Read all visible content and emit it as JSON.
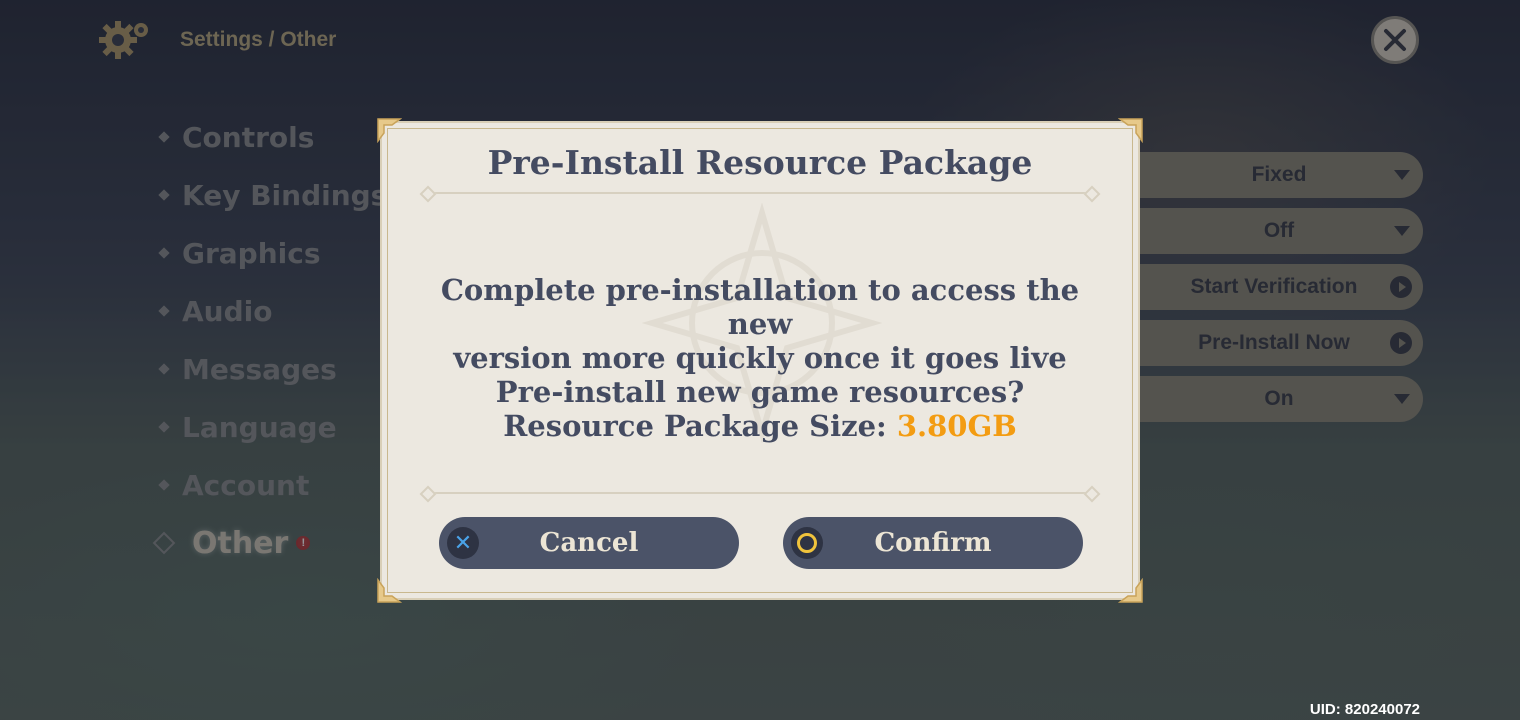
{
  "header": {
    "breadcrumb": "Settings / Other",
    "settings_icon": "gear-icon",
    "close_icon": "close-icon"
  },
  "sidebar": {
    "items": [
      {
        "label": "Controls"
      },
      {
        "label": "Key Bindings"
      },
      {
        "label": "Graphics"
      },
      {
        "label": "Audio"
      },
      {
        "label": "Messages"
      },
      {
        "label": "Language"
      },
      {
        "label": "Account"
      },
      {
        "label": "Other",
        "active": true,
        "badge": "!"
      }
    ]
  },
  "settings_controls": [
    {
      "value": "Fixed",
      "kind": "dropdown"
    },
    {
      "value": "Off",
      "kind": "dropdown"
    },
    {
      "value": "Start Verification",
      "kind": "action"
    },
    {
      "value": "Pre-Install Now",
      "kind": "action"
    },
    {
      "value": "On",
      "kind": "dropdown"
    }
  ],
  "dialog": {
    "title": "Pre-Install Resource Package",
    "line1": "Complete pre-installation to access the new",
    "line2": "version more quickly once it goes live",
    "line3": "Pre-install new game resources?",
    "size_label": "Resource Package Size: ",
    "size_value": "3.80GB",
    "cancel_label": "Cancel",
    "confirm_label": "Confirm"
  },
  "footer": {
    "uid": "UID: 820240072"
  },
  "colors": {
    "accent_orange": "#f39c12",
    "button_bg": "#4b5368",
    "dialog_bg": "#ece8e0",
    "text_dark": "#444b61"
  }
}
